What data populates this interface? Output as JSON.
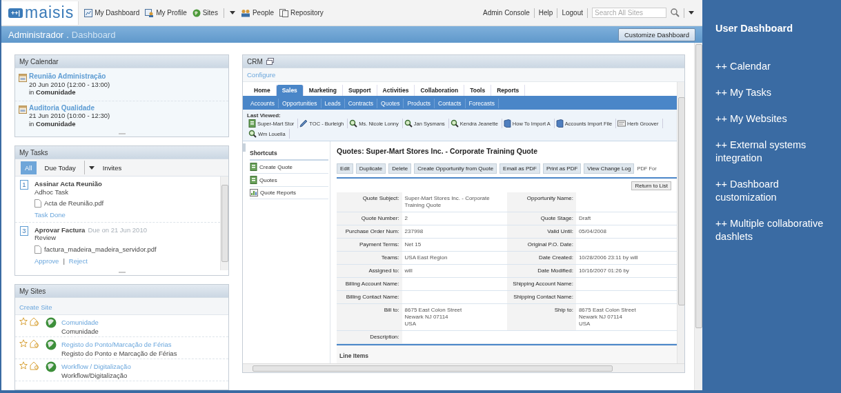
{
  "header": {
    "logo": {
      "badge": "++|",
      "name": "maisis"
    },
    "nav": [
      {
        "label": "My Dashboard",
        "kind": "dashboard"
      },
      {
        "label": "My Profile",
        "kind": "profile"
      },
      {
        "label": "Sites",
        "kind": "globe",
        "dropdown": true
      },
      {
        "label": "People",
        "kind": "people"
      },
      {
        "label": "Repository",
        "kind": "repository"
      }
    ],
    "links": [
      "Admin Console",
      "Help",
      "Logout"
    ],
    "search": {
      "placeholder": "Search All Sites"
    }
  },
  "title_bar": {
    "user": "Administrador",
    "separator": ".",
    "page": "Dashboard",
    "button": "Customize Dashboard"
  },
  "calendar": {
    "title": "My Calendar",
    "events": [
      {
        "title": "Reunião Administração",
        "when": "20 Jun 2010 (12:00 - 13:00)",
        "prefix": "in",
        "site": "Comunidade"
      },
      {
        "title": "Auditoria Qualidade",
        "when": "21 Jun 2010 (10:00 - 12:30)",
        "prefix": "in",
        "site": "Comunidade"
      }
    ]
  },
  "tasks": {
    "title": "My Tasks",
    "filters": [
      {
        "label": "All",
        "selected": true
      },
      {
        "label": "Due Today",
        "selected": false,
        "dropdown": true
      },
      {
        "label": "Invites",
        "selected": false
      }
    ],
    "action_separator": "|",
    "items": [
      {
        "number": "1",
        "title": "Assinar Acta Reunião",
        "type": "Adhoc Task",
        "file": "Acta de Reunião.pdf",
        "actions": [
          "Task Done"
        ]
      },
      {
        "number": "3",
        "title": "Aprovar Factura",
        "due": "Due on 21 Jun 2010",
        "type": "Review",
        "file": "factura_madeira_madeira_servidor.pdf",
        "actions": [
          "Approve",
          "Reject"
        ]
      }
    ]
  },
  "sites": {
    "title": "My Sites",
    "create": "Create Site",
    "items": [
      {
        "name": "Comunidade",
        "description": "Comunidade"
      },
      {
        "name": "Registo do Ponto/Marcação de Férias",
        "description": "Registo do Ponto e Marcação de Férias"
      },
      {
        "name": "Workflow / Digitalização",
        "description": "Workflow/Digitalização"
      }
    ]
  },
  "crm": {
    "title": "CRM",
    "configure": "Configure",
    "tabs": [
      {
        "label": "Home",
        "selected": false
      },
      {
        "label": "Sales",
        "selected": true
      },
      {
        "label": "Marketing",
        "selected": false
      },
      {
        "label": "Support",
        "selected": false
      },
      {
        "label": "Activities",
        "selected": false
      },
      {
        "label": "Collaboration",
        "selected": false
      },
      {
        "label": "Tools",
        "selected": false
      },
      {
        "label": "Reports",
        "selected": false
      }
    ],
    "subtabs": [
      "Accounts",
      "Opportunities",
      "Leads",
      "Contracts",
      "Quotes",
      "Products",
      "Contacts",
      "Forecasts"
    ],
    "last_viewed": {
      "label": "Last Viewed:",
      "items": [
        {
          "label": "Super-Mart Stor",
          "kind": "quote"
        },
        {
          "label": "TOC - Burleigh",
          "kind": "pencil"
        },
        {
          "label": "Ms. Nicole Lonny",
          "kind": "contact"
        },
        {
          "label": "Jan Sysmans",
          "kind": "contact"
        },
        {
          "label": "Kendra Jeanette",
          "kind": "contact"
        },
        {
          "label": "How To Import A",
          "kind": "book"
        },
        {
          "label": "Accounts Import File",
          "kind": "book"
        },
        {
          "label": "Herb Groover",
          "kind": "card"
        },
        {
          "label": "Wm Louella",
          "kind": "contact"
        }
      ]
    },
    "shortcuts": {
      "title": "Shortcuts",
      "items": [
        {
          "label": "Create Quote",
          "kind": "quote"
        },
        {
          "label": "Quotes",
          "kind": "quote"
        },
        {
          "label": "Quote Reports",
          "kind": "report"
        }
      ]
    },
    "record": {
      "title": "Quotes: Super-Mart Stores Inc. - Corporate Training Quote",
      "buttons": [
        "Edit",
        "Duplicate",
        "Delete",
        "Create Opportunity from Quote",
        "Email as PDF",
        "Print as PDF",
        "View Change Log"
      ],
      "extra": "PDF For",
      "return": "Return to List",
      "rows": [
        {
          "label": "Quote Subject:",
          "value": "Super-Mart Stores Inc. - Corporate Training Quote",
          "label2": "Opportunity Name:"
        },
        {
          "label": "Quote Number:",
          "value": "2",
          "label2": "Quote Stage:",
          "value2": "Draft"
        },
        {
          "label": "Purchase Order Num:",
          "value": "237998",
          "label2": "Valid Until:",
          "value2": "05/04/2008"
        },
        {
          "label": "Payment Terms:",
          "value": "Net 15",
          "label2": "Original P.O. Date:"
        },
        {
          "label": "Teams:",
          "value": "USA East Region",
          "label2": "Date Created:",
          "value2": "10/28/2006 23:11 by will"
        },
        {
          "label": "Assigned to:",
          "value": "will",
          "label2": "Date Modified:",
          "value2": "10/16/2007 01:26 by"
        },
        {
          "label": "Billing Account Name:",
          "label2": "Shipping Account Name:"
        },
        {
          "label": "Billing Contact Name:",
          "label2": "Shipping Contact Name:"
        },
        {
          "label": "Bill to:",
          "value": "8675 East Colon Street\nNewark NJ  07114\nUSA",
          "label2": "Ship to:",
          "value2": "8675 East Colon Street\nNewark NJ  07114\nUSA"
        },
        {
          "label": "Description:"
        }
      ],
      "section": "Line Items"
    }
  },
  "side_panel": {
    "title": "User Dashboard",
    "items": [
      "++ Calendar",
      "++ My Tasks",
      "++ My Websites",
      "++ External systems integration",
      "++ Dashboard customization",
      "++ Multiple collaborative dashlets"
    ]
  }
}
